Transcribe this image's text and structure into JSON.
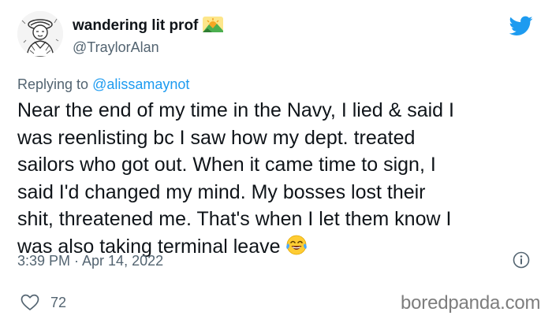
{
  "user": {
    "display_name": "wandering lit prof",
    "handle": "@TraylorAlan",
    "avatar_icon": "sailor-sketch-avatar",
    "name_emoji": "sunrise-over-mountains-emoji"
  },
  "reply": {
    "prefix": "Replying to",
    "mention": "@alissamaynot"
  },
  "tweet": {
    "lines": [
      "Near the end of my time in the Navy, I lied & said I",
      "was reenlisting bc I saw how my dept. treated",
      "sailors who got out. When it came time to sign, I",
      "said I'd changed my mind. My bosses lost their",
      "shit, threatened me. That's when I let them know I",
      "was also taking terminal leave"
    ],
    "end_emoji": "face-with-tears-of-joy-emoji"
  },
  "meta": {
    "timestamp": "3:39 PM · Apr 14, 2022"
  },
  "engagement": {
    "likes": "72"
  },
  "watermark": "boredpanda.com",
  "colors": {
    "link": "#1d9bf0",
    "secondary_text": "#536471",
    "twitter_blue": "#1d9bf0"
  }
}
